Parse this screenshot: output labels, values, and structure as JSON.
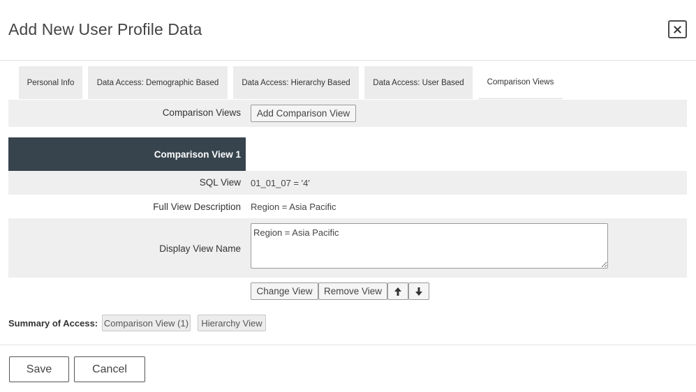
{
  "dialog": {
    "title": "Add New User Profile Data"
  },
  "tabs": [
    {
      "label": "Personal Info"
    },
    {
      "label": "Data Access: Demographic Based"
    },
    {
      "label": "Data Access: Hierarchy Based"
    },
    {
      "label": "Data Access: User Based"
    },
    {
      "label": "Comparison Views",
      "active": true
    }
  ],
  "comparison": {
    "label": "Comparison Views",
    "add_button": "Add Comparison View",
    "view": {
      "header": "Comparison View 1",
      "sql_label": "SQL View",
      "sql_value": "01_01_07 = '4'",
      "full_desc_label": "Full View Description",
      "full_desc_value": "Region = Asia Pacific",
      "display_name_label": "Display View Name",
      "display_name_value": "Region = Asia Pacific"
    },
    "actions": {
      "change": "Change View",
      "remove": "Remove View",
      "move_up_icon": "arrow-up-icon",
      "move_down_icon": "arrow-down-icon"
    }
  },
  "summary": {
    "label": "Summary of Access:",
    "chips": [
      "Comparison View (1)",
      "Hierarchy View"
    ]
  },
  "footer": {
    "save": "Save",
    "cancel": "Cancel"
  },
  "colors": {
    "header_bar": "#37444e",
    "row_gray": "#efefef",
    "tab_gray": "#ececec"
  }
}
